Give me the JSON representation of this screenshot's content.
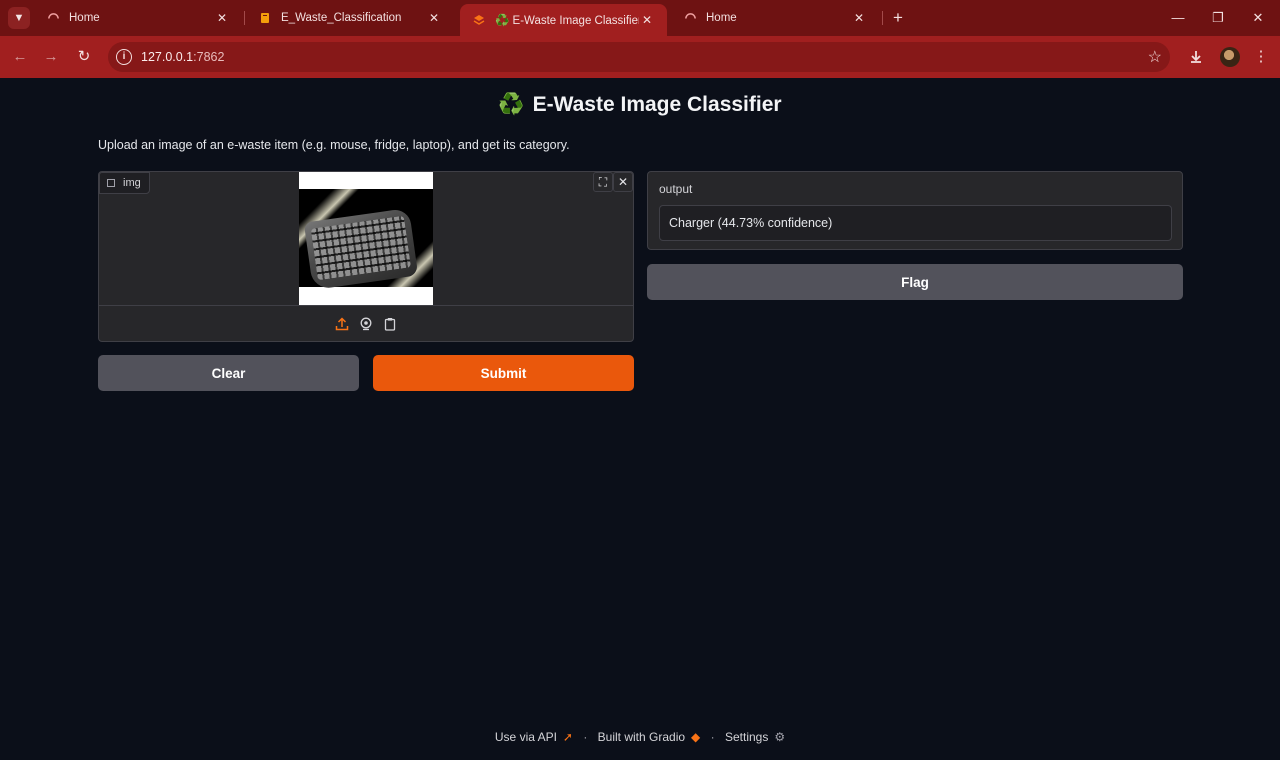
{
  "browser": {
    "tabs": [
      {
        "title": "Home",
        "favicon": "loading-spinner-icon",
        "active": false
      },
      {
        "title": "E_Waste_Classification",
        "favicon": "notebook-icon",
        "active": false
      },
      {
        "title": "E-Waste Image Classifier",
        "favicon": "gradio-icon",
        "active": true,
        "title_emoji": "♻️"
      },
      {
        "title": "Home",
        "favicon": "loading-spinner-icon",
        "active": false
      }
    ],
    "url_host": "127.0.0.1",
    "url_port": ":7862",
    "theme_color": "#a11f1f"
  },
  "app": {
    "title": "E-Waste Image Classifier",
    "title_emoji": "♻️",
    "description": "Upload an image of an e-waste item (e.g. mouse, fridge, laptop), and get its category.",
    "input": {
      "label": "img",
      "image_subject": "keyboard"
    },
    "buttons": {
      "clear": "Clear",
      "submit": "Submit",
      "flag": "Flag"
    },
    "output": {
      "label": "output",
      "value": "Charger (44.73% confidence)"
    },
    "accent_color": "#ea580c"
  },
  "footer": {
    "api": "Use via API",
    "built": "Built with Gradio",
    "settings": "Settings",
    "separator": "·"
  }
}
